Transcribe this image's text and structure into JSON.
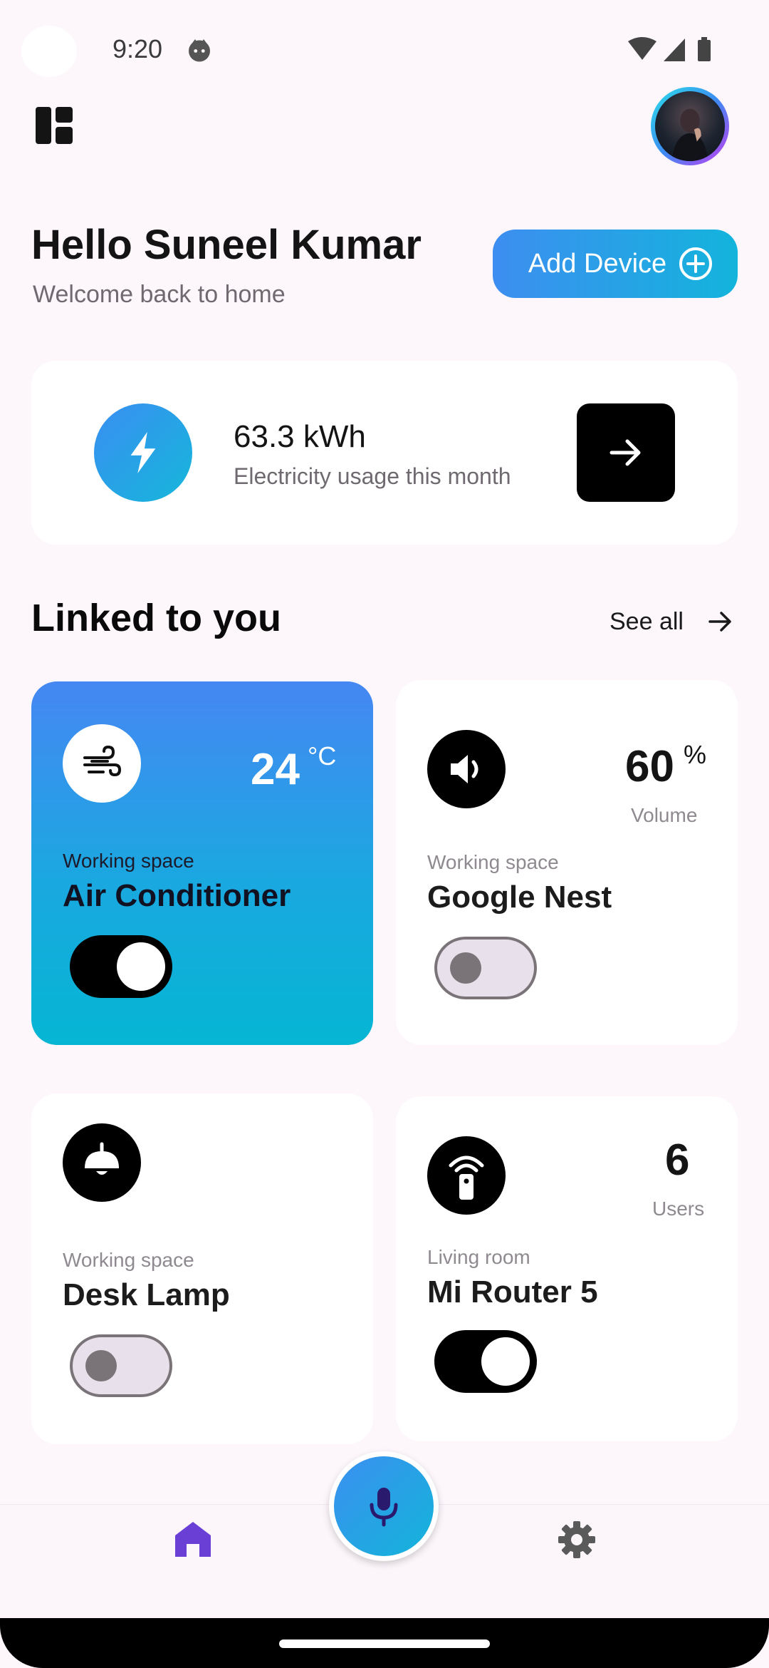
{
  "status_bar": {
    "time": "9:20"
  },
  "header": {
    "greeting": "Hello Suneel Kumar",
    "subtitle": "Welcome back to home",
    "add_device_label": "Add Device"
  },
  "energy": {
    "value": "63.3 kWh",
    "label": "Electricity usage this month"
  },
  "section": {
    "title": "Linked to you",
    "see_all": "See all"
  },
  "devices": [
    {
      "room": "Working space",
      "name": "Air Conditioner",
      "metric": "24",
      "unit": "°C",
      "metric_label": "",
      "icon": "wind-icon",
      "on": true
    },
    {
      "room": "Working space",
      "name": "Google Nest",
      "metric": "60",
      "unit": "%",
      "metric_label": "Volume",
      "icon": "speaker-icon",
      "on": false
    },
    {
      "room": "Working space",
      "name": "Desk Lamp",
      "metric": "",
      "unit": "",
      "metric_label": "",
      "icon": "lamp-icon",
      "on": false
    },
    {
      "room": "Living room",
      "name": "Mi Router 5",
      "metric": "6",
      "unit": "",
      "metric_label": "Users",
      "icon": "router-icon",
      "on": true
    }
  ],
  "nav": {
    "items": [
      "home-icon",
      "mic-icon",
      "settings-icon"
    ],
    "active": "home-icon"
  },
  "colors": {
    "accent_start": "#3d8ef0",
    "accent_end": "#13b4dc",
    "nav_active": "#6a3fd6",
    "background": "#fdf7fc"
  }
}
